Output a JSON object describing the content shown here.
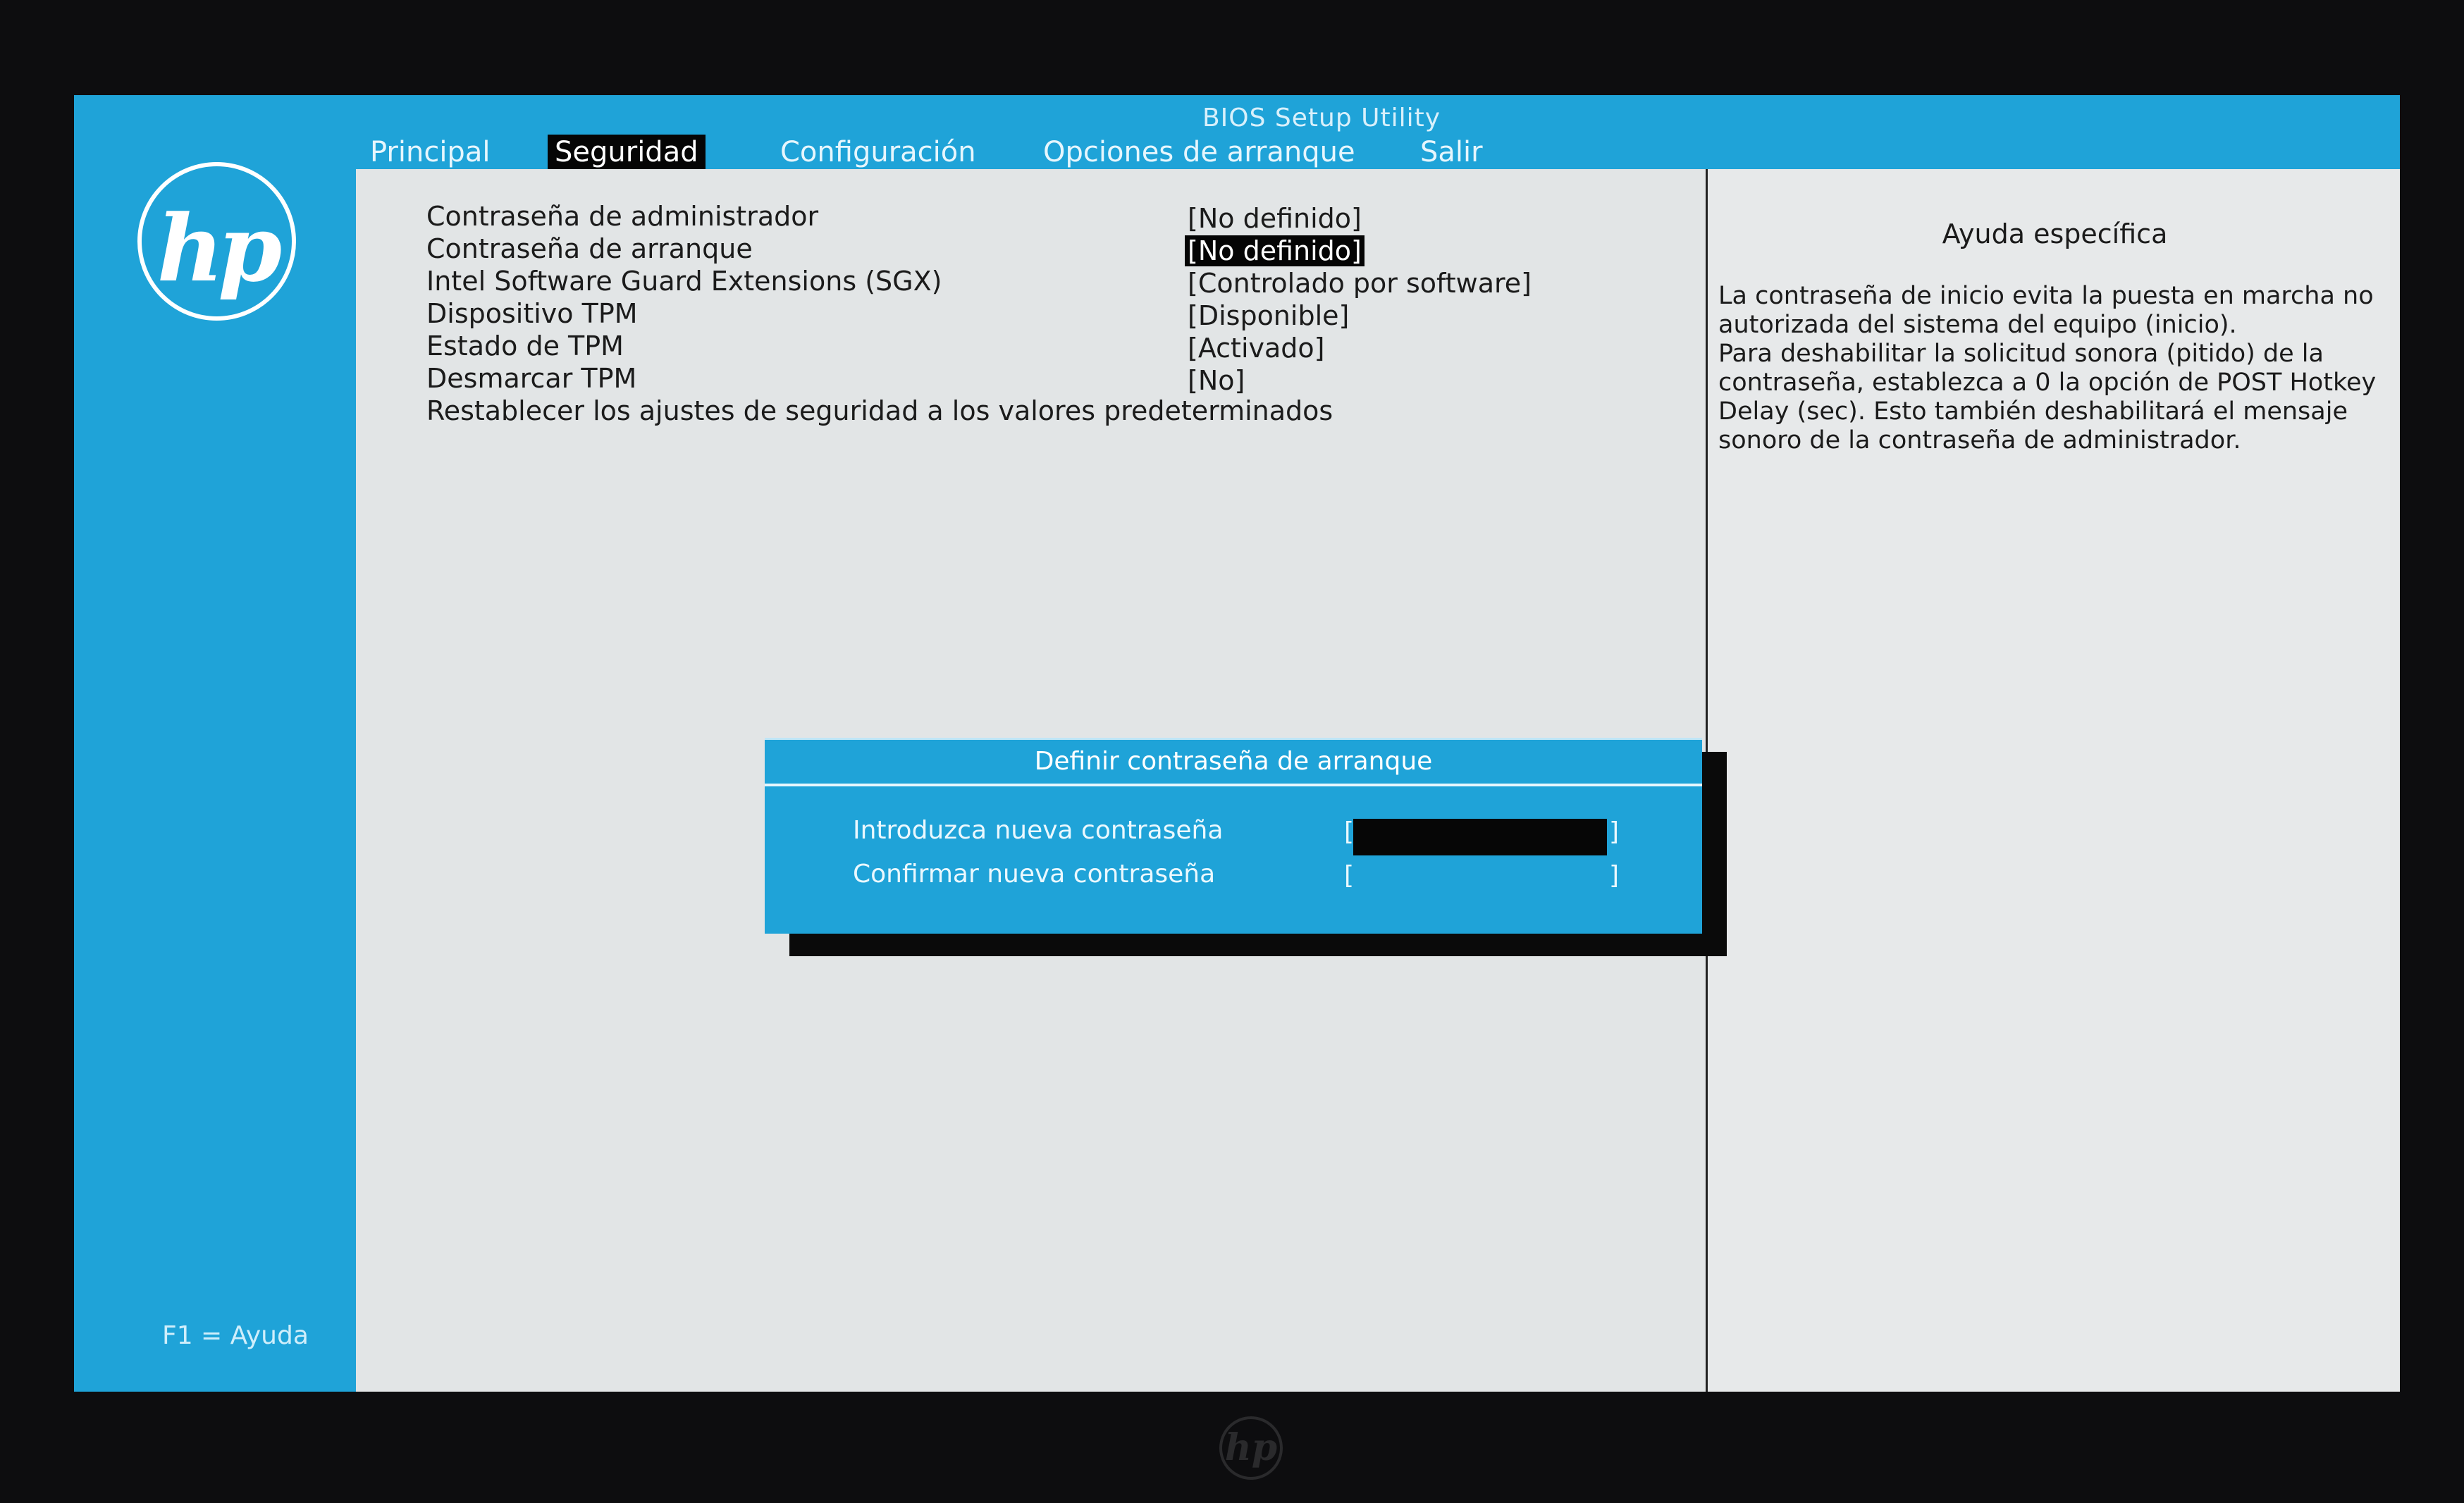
{
  "window": {
    "title": "BIOS Setup Utility"
  },
  "logo": {
    "text": "hp"
  },
  "menu": {
    "tabs": [
      {
        "label": "Principal"
      },
      {
        "label": "Seguridad",
        "active": true
      },
      {
        "label": "Configuración"
      },
      {
        "label": "Opciones de arranque"
      },
      {
        "label": "Salir"
      }
    ]
  },
  "settings": [
    {
      "label": "Contraseña de administrador",
      "value": "[No definido]"
    },
    {
      "label": "Contraseña de arranque",
      "value": "[No definido]",
      "selected": true
    },
    {
      "label": "Intel Software Guard Extensions (SGX)",
      "value": "[Controlado por software]"
    },
    {
      "label": "Dispositivo TPM",
      "value": "[Disponible]"
    },
    {
      "label": "Estado de TPM",
      "value": "[Activado]"
    },
    {
      "label": "Desmarcar TPM",
      "value": "[No]"
    },
    {
      "label": "Restablecer los ajustes de seguridad a los valores predeterminados",
      "value": ""
    }
  ],
  "help": {
    "title": "Ayuda específica",
    "text": "La contraseña de inicio evita la puesta en marcha no autorizada del sistema del equipo (inicio).\nPara deshabilitar la solicitud sonora (pitido) de la contraseña, establezca a 0 la opción de POST Hotkey Delay (sec). Esto también deshabilitará el mensaje sonoro de la contraseña de administrador."
  },
  "dialog": {
    "title": "Definir contraseña de arranque",
    "new_password_label": "Introduzca nueva contraseña",
    "confirm_password_label": "Confirmar nueva contraseña",
    "bracket_open": "[",
    "bracket_close": "]"
  },
  "footer": {
    "help_hint": "F1 = Ayuda"
  },
  "colors": {
    "bios_blue": "#1fa3d8",
    "panel_gray": "#e2e5e6",
    "selection": "#050505"
  }
}
